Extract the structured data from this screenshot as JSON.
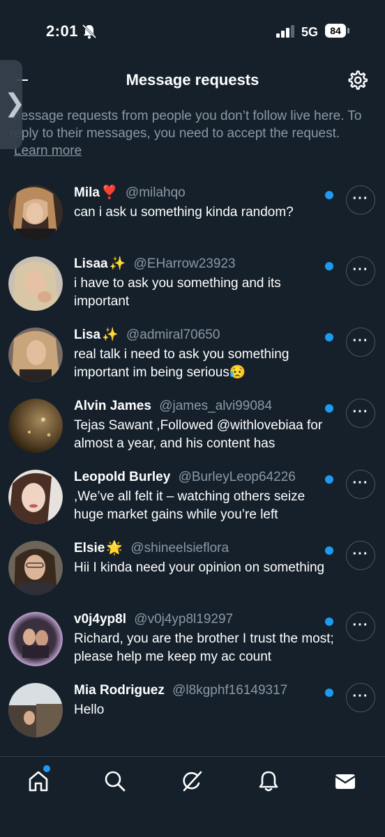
{
  "status_bar": {
    "time": "2:01",
    "network": "5G",
    "battery": "84"
  },
  "header": {
    "title": "Message requests"
  },
  "intro": {
    "text": "Message requests from people you don’t follow live here. To reply to their messages, you need to accept the request.",
    "link": "Learn more"
  },
  "requests": [
    {
      "name": "Mila",
      "emoji": "❣️",
      "handle": "@milahqo",
      "message": "can i ask u something kinda random?",
      "unread": true
    },
    {
      "name": "Lisaa",
      "emoji": "✨",
      "handle": "@EHarrow23923",
      "message": "i have to ask you something and its important",
      "unread": true
    },
    {
      "name": "Lisa",
      "emoji": "✨",
      "handle": "@admiral70650",
      "message": "real talk i need to ask you something important im being serious😥",
      "unread": true
    },
    {
      "name": "Alvin James",
      "emoji": "",
      "handle": "@james_alvi99084",
      "message": "Tejas Sawant ,Followed @withlovebiaa for almost a year, and his content has",
      "unread": true
    },
    {
      "name": "Leopold Burley",
      "emoji": "",
      "handle": "@BurleyLeop64226",
      "message": ",We’ve all felt it – watching others seize huge market gains while you’re left",
      "unread": true
    },
    {
      "name": "Elsie",
      "emoji": "🌟",
      "handle": "@shineelsieflora",
      "message": "Hii I kinda need your opinion on something",
      "unread": true
    },
    {
      "name": "v0j4yp8l",
      "emoji": "",
      "handle": "@v0j4yp8l19297",
      "message": "Richard, you are the brother I trust the most; please help me keep my ac count",
      "unread": true
    },
    {
      "name": "Mia Rodriguez",
      "emoji": "",
      "handle": "@l8kgphf16149317",
      "message": "Hello",
      "unread": true
    }
  ],
  "tabbar": {
    "items": [
      {
        "icon": "home-icon",
        "active": false,
        "has_dot": true
      },
      {
        "icon": "search-icon",
        "active": false
      },
      {
        "icon": "grok-icon",
        "active": false
      },
      {
        "icon": "notifications-icon",
        "active": false
      },
      {
        "icon": "messages-icon",
        "active": true
      }
    ]
  },
  "colors": {
    "background": "#15202b",
    "accent": "#1d9bf0",
    "secondary_text": "#8b98a5"
  }
}
